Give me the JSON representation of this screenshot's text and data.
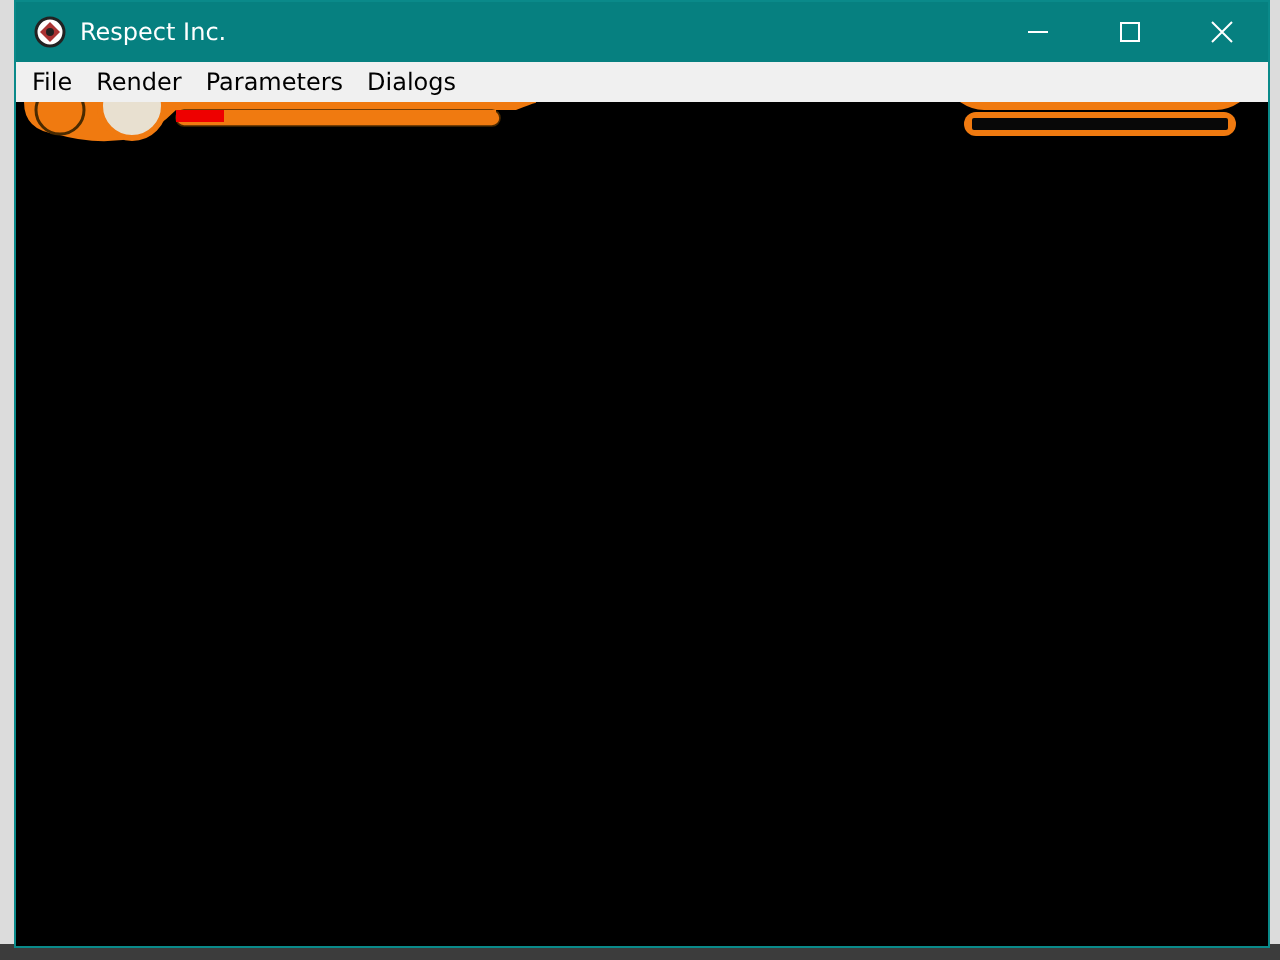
{
  "window": {
    "title": "Respect Inc."
  },
  "menu": [
    {
      "label": "File"
    },
    {
      "label": "Render"
    },
    {
      "label": "Parameters"
    },
    {
      "label": "Dialogs"
    }
  ],
  "hud": {
    "health": {
      "level": 0.15
    }
  }
}
